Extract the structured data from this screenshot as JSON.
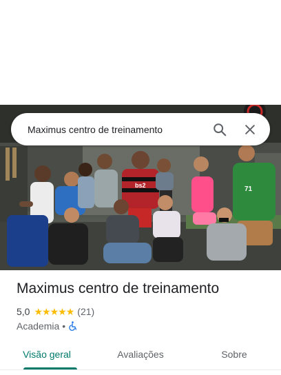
{
  "search": {
    "value": "Maximus centro de treinamento",
    "search_icon": "search-icon",
    "clear_icon": "close-icon"
  },
  "hero": {
    "jersey_text": "bs2"
  },
  "place": {
    "name": "Maximus centro de treinamento",
    "rating": "5,0",
    "stars": 5,
    "review_count": "(21)",
    "category": "Academia",
    "separator": "•",
    "accessibility_icon": "wheelchair-icon"
  },
  "tabs": [
    {
      "label": "Visão geral",
      "active": true
    },
    {
      "label": "Avaliações",
      "active": false
    },
    {
      "label": "Sobre",
      "active": false
    }
  ],
  "colors": {
    "accent": "#00796b",
    "star": "#fbbc04",
    "accessibility": "#1a73e8"
  }
}
